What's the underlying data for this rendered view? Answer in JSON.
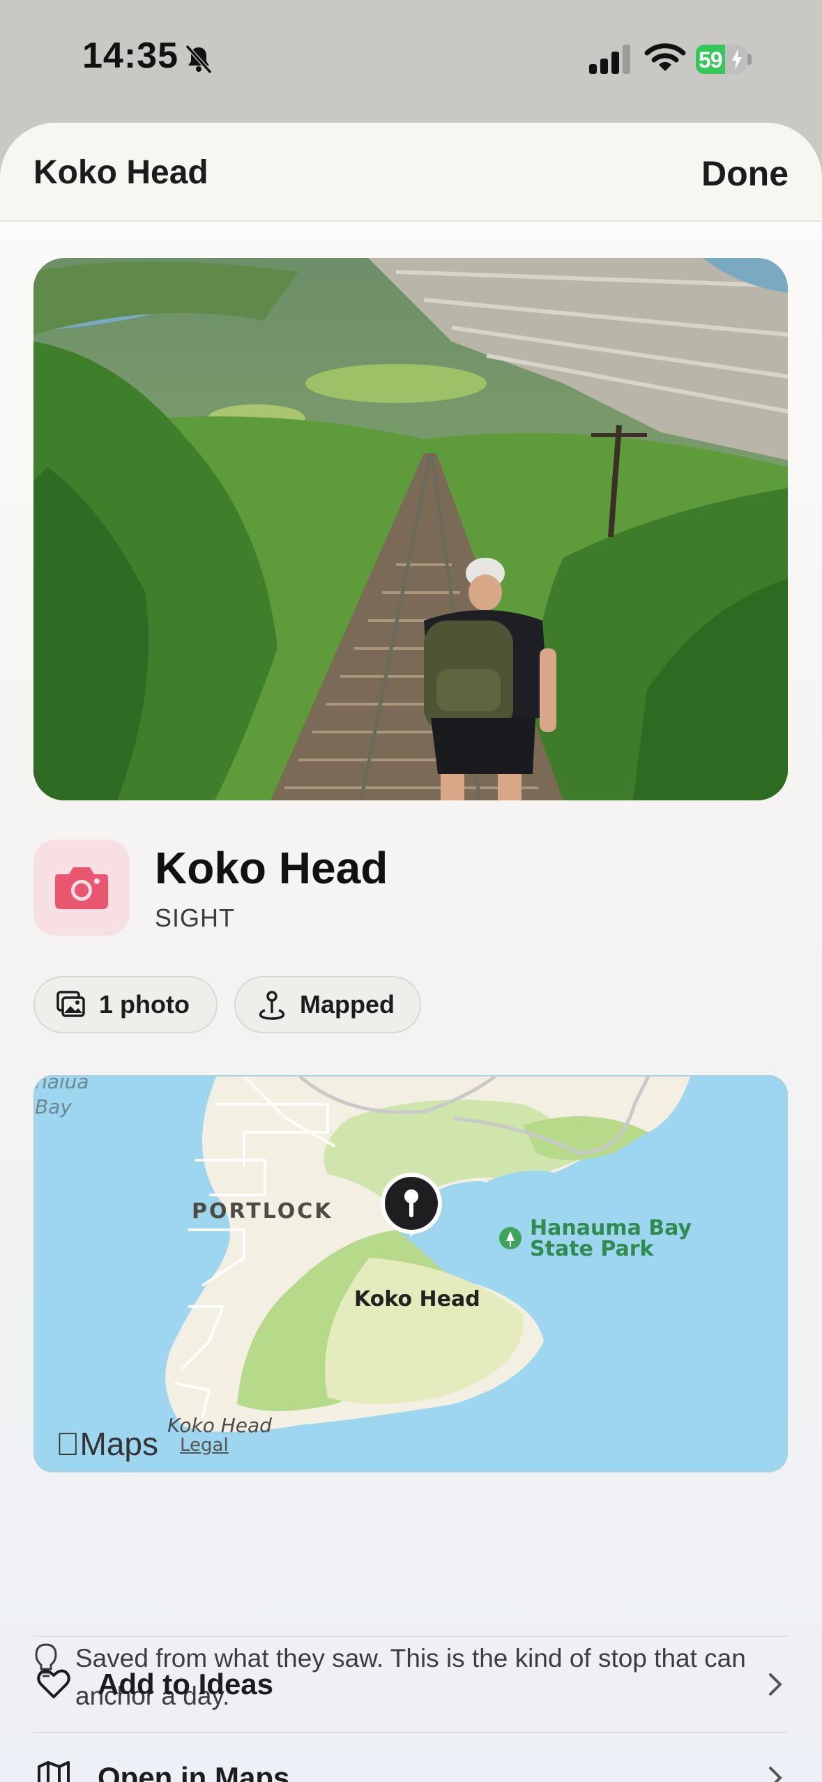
{
  "status_bar": {
    "time": "14:35",
    "battery_percent": "59",
    "battery_level": 0.59,
    "icons": [
      "bell-slash-icon",
      "cellular-signal-icon",
      "wifi-icon",
      "battery-charging-icon"
    ]
  },
  "sheet": {
    "title": "Koko Head",
    "done_label": "Done"
  },
  "place": {
    "name": "Koko Head",
    "category": "SIGHT",
    "category_icon": "camera-icon",
    "accent_color": "#e8576f"
  },
  "chips": {
    "photos_label": "1 photo",
    "photos_icon": "photos-icon",
    "mapped_label": "Mapped",
    "mapped_icon": "map-pin-icon"
  },
  "map": {
    "area_labels": {
      "portlock": "PORTLOCK",
      "pin_label": "Koko Head",
      "park_label_line1": "Hanauma Bay",
      "park_label_line2": "State Park",
      "water_label": "Koko Head",
      "bay_label": "naiua\nBay"
    },
    "brand": "Maps",
    "legal": "Legal"
  },
  "tip": {
    "text": "Saved from what they saw. This is the kind of stop that can anchor a day.",
    "icon": "lightbulb-icon"
  },
  "actions": [
    {
      "label": "Add to Ideas",
      "icon": "heart-icon"
    },
    {
      "label": "Open in Maps",
      "icon": "map-icon"
    }
  ]
}
